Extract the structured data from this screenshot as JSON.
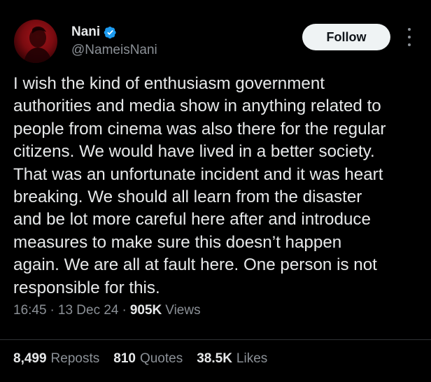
{
  "author": {
    "display_name": "Nani",
    "handle": "@NameisNani",
    "verified_color": "#1d9bf0"
  },
  "follow_label": "Follow",
  "tweet_text": "I wish the kind of enthusiasm government\nauthorities and media show in anything related to\npeople from cinema was also there for the regular\ncitizens. We would have lived in a better society.\nThat was an unfortunate incident and it was heart\nbreaking. We should all learn from the disaster\nand be lot more careful here after and introduce\nmeasures to make sure this doesn’t happen\nagain. We are all at fault here. One person is not\nresponsible for this.",
  "meta": {
    "time": "16:45",
    "sep": "·",
    "date": "13 Dec 24",
    "views_count": "905K",
    "views_label": "Views"
  },
  "stats": {
    "reposts_count": "8,499",
    "reposts_label": "Reposts",
    "quotes_count": "810",
    "quotes_label": "Quotes",
    "likes_count": "38.5K",
    "likes_label": "Likes"
  },
  "icons": {
    "verified": "verified-badge-icon",
    "more": "more-options-icon"
  }
}
